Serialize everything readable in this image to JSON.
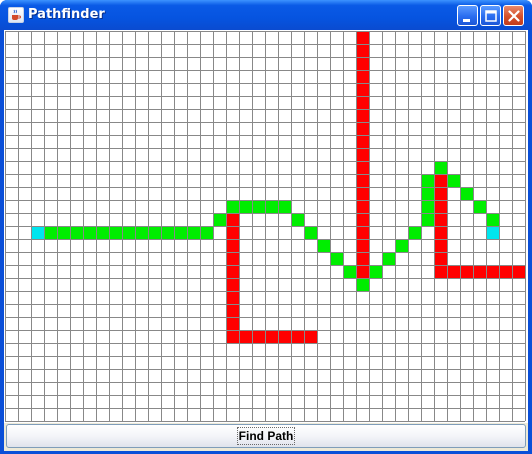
{
  "window": {
    "title": "Pathfinder",
    "icon": "java-coffee-icon",
    "controls": [
      "minimize-icon",
      "maximize-icon",
      "close-icon"
    ]
  },
  "grid": {
    "columns": 40,
    "rows": 30,
    "colors": {
      "background": "#ffffff",
      "gridline": "#888888",
      "wall": "#ff0000",
      "path": "#00ee00",
      "endpoint": "#00e5ee"
    },
    "walls": [
      [
        27,
        0
      ],
      [
        27,
        1
      ],
      [
        27,
        2
      ],
      [
        27,
        3
      ],
      [
        27,
        4
      ],
      [
        27,
        5
      ],
      [
        27,
        6
      ],
      [
        27,
        7
      ],
      [
        27,
        8
      ],
      [
        27,
        9
      ],
      [
        27,
        10
      ],
      [
        27,
        11
      ],
      [
        27,
        12
      ],
      [
        27,
        13
      ],
      [
        27,
        14
      ],
      [
        27,
        15
      ],
      [
        27,
        16
      ],
      [
        27,
        17
      ],
      [
        27,
        18
      ],
      [
        17,
        14
      ],
      [
        17,
        15
      ],
      [
        17,
        16
      ],
      [
        17,
        17
      ],
      [
        17,
        18
      ],
      [
        17,
        19
      ],
      [
        17,
        20
      ],
      [
        17,
        21
      ],
      [
        17,
        22
      ],
      [
        17,
        23
      ],
      [
        18,
        23
      ],
      [
        19,
        23
      ],
      [
        20,
        23
      ],
      [
        21,
        23
      ],
      [
        22,
        23
      ],
      [
        23,
        23
      ],
      [
        33,
        11
      ],
      [
        33,
        12
      ],
      [
        33,
        13
      ],
      [
        33,
        14
      ],
      [
        33,
        15
      ],
      [
        33,
        16
      ],
      [
        33,
        17
      ],
      [
        33,
        18
      ],
      [
        34,
        18
      ],
      [
        35,
        18
      ],
      [
        36,
        18
      ],
      [
        37,
        18
      ],
      [
        38,
        18
      ],
      [
        39,
        18
      ]
    ],
    "path": [
      [
        3,
        15
      ],
      [
        4,
        15
      ],
      [
        5,
        15
      ],
      [
        6,
        15
      ],
      [
        7,
        15
      ],
      [
        8,
        15
      ],
      [
        9,
        15
      ],
      [
        10,
        15
      ],
      [
        11,
        15
      ],
      [
        12,
        15
      ],
      [
        13,
        15
      ],
      [
        14,
        15
      ],
      [
        15,
        15
      ],
      [
        16,
        14
      ],
      [
        17,
        13
      ],
      [
        18,
        13
      ],
      [
        19,
        13
      ],
      [
        20,
        13
      ],
      [
        21,
        13
      ],
      [
        22,
        14
      ],
      [
        23,
        15
      ],
      [
        24,
        16
      ],
      [
        25,
        17
      ],
      [
        26,
        18
      ],
      [
        27,
        19
      ],
      [
        28,
        18
      ],
      [
        29,
        17
      ],
      [
        30,
        16
      ],
      [
        31,
        15
      ],
      [
        32,
        14
      ],
      [
        32,
        13
      ],
      [
        32,
        12
      ],
      [
        32,
        11
      ],
      [
        33,
        10
      ],
      [
        34,
        11
      ],
      [
        35,
        12
      ],
      [
        36,
        13
      ],
      [
        37,
        14
      ]
    ],
    "endpoints": [
      [
        2,
        15
      ],
      [
        37,
        15
      ]
    ]
  },
  "actions": {
    "find_path_label": "Find Path"
  }
}
